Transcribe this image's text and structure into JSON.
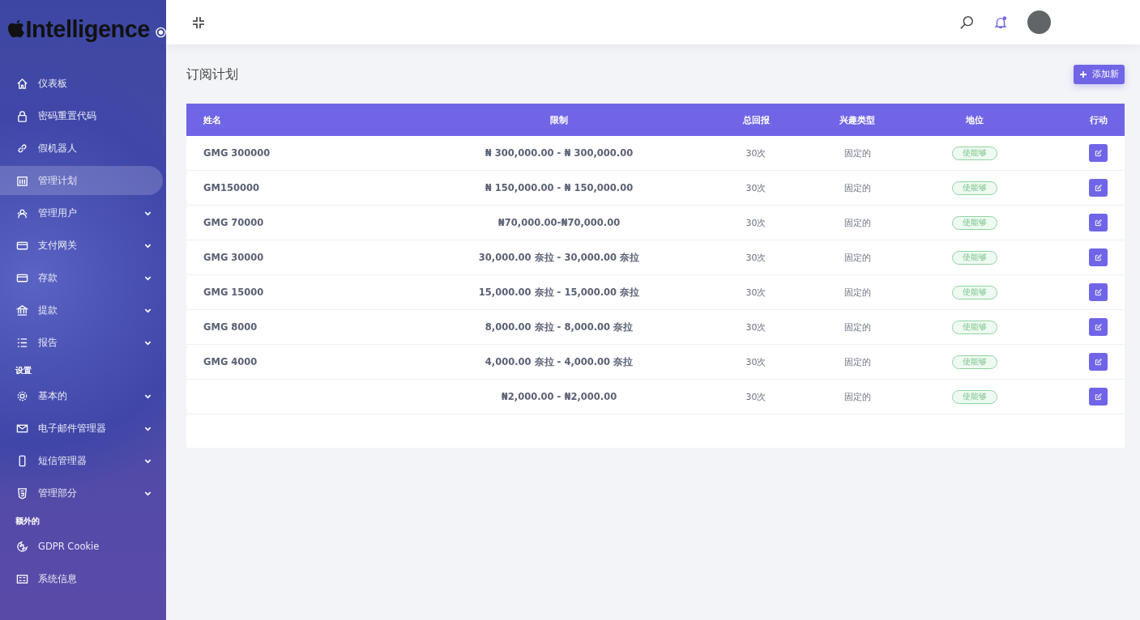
{
  "sidebar": {
    "logo": "Intelligence",
    "sections": [
      {
        "items": [
          {
            "label": "仪表板",
            "selected": false,
            "has_submenu": false
          },
          {
            "label": "密码重置代码",
            "selected": false,
            "has_submenu": false
          },
          {
            "label": "假机器人",
            "selected": false,
            "has_submenu": false
          },
          {
            "label": "管理计划",
            "selected": true,
            "has_submenu": false
          },
          {
            "label": "管理用户",
            "selected": false,
            "has_submenu": true
          },
          {
            "label": "支付网关",
            "selected": false,
            "has_submenu": true
          },
          {
            "label": "存款",
            "selected": false,
            "has_submenu": true
          },
          {
            "label": "提款",
            "selected": false,
            "has_submenu": true
          },
          {
            "label": "报告",
            "selected": false,
            "has_submenu": true
          }
        ]
      },
      {
        "heading": "设置",
        "items": [
          {
            "label": "基本的",
            "selected": false,
            "has_submenu": true
          },
          {
            "label": "电子邮件管理器",
            "selected": false,
            "has_submenu": true
          },
          {
            "label": "短信管理器",
            "selected": false,
            "has_submenu": true
          },
          {
            "label": "管理部分",
            "selected": false,
            "has_submenu": true
          }
        ]
      },
      {
        "heading": "额外的",
        "items": [
          {
            "label": "GDPR Cookie",
            "selected": false,
            "has_submenu": false
          },
          {
            "label": "系统信息",
            "selected": false,
            "has_submenu": false
          }
        ]
      }
    ]
  },
  "topbar": {
    "notification_unread": true
  },
  "page": {
    "title": "订阅计划",
    "add_button": "添加新"
  },
  "table": {
    "columns": [
      "姓名",
      "限制",
      "总回报",
      "兴趣类型",
      "地位",
      "行动"
    ],
    "rows": [
      {
        "name": "GMG 300000",
        "limit": "₦ 300,000.00 - ₦ 300,000.00",
        "return": "30次",
        "interest_type": "固定的",
        "status": "使能够",
        "enabled": true
      },
      {
        "name": "GM150000",
        "limit": "₦ 150,000.00 - ₦ 150,000.00",
        "return": "30次",
        "interest_type": "固定的",
        "status": "使能够",
        "enabled": true
      },
      {
        "name": "GMG 70000",
        "limit": "₦70,000.00-₦70,000.00",
        "return": "30次",
        "interest_type": "固定的",
        "status": "使能够",
        "enabled": true
      },
      {
        "name": "GMG 30000",
        "limit": "30,000.00 奈拉 - 30,000.00 奈拉",
        "return": "30次",
        "interest_type": "固定的",
        "status": "使能够",
        "enabled": true
      },
      {
        "name": "GMG 15000",
        "limit": "15,000.00 奈拉 - 15,000.00 奈拉",
        "return": "30次",
        "interest_type": "固定的",
        "status": "使能够",
        "enabled": true
      },
      {
        "name": "GMG 8000",
        "limit": "8,000.00 奈拉 - 8,000.00 奈拉",
        "return": "30次",
        "interest_type": "固定的",
        "status": "使能够",
        "enabled": true
      },
      {
        "name": "GMG 4000",
        "limit": "4,000.00 奈拉 - 4,000.00 奈拉",
        "return": "30次",
        "interest_type": "固定的",
        "status": "使能够",
        "enabled": true
      },
      {
        "limit": "₦2,000.00 - ₦2,000.00",
        "return": "30次",
        "interest_type": "固定的",
        "status": "使能够",
        "enabled": true
      }
    ]
  }
}
